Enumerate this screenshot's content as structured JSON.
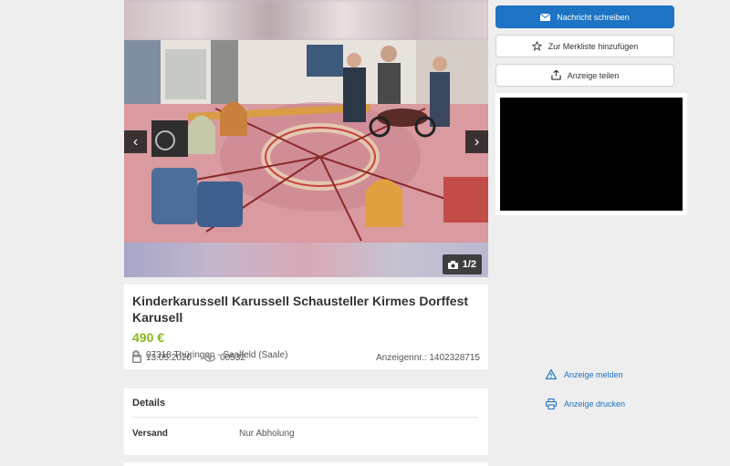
{
  "gallery": {
    "counter": "1/2",
    "prev_icon": "chevron-left-icon",
    "next_icon": "chevron-right-icon",
    "counter_icon": "camera-icon"
  },
  "ad": {
    "title": "Kinderkarussell Karussell Schausteller Kirmes Dorffest Karusell",
    "price": "490 €",
    "location": "07318 Thüringen - Saalfeld (Saale)",
    "date": "13.05.2020",
    "views": "00532",
    "ad_number": "Anzeigennr.: 1402328715"
  },
  "details": {
    "title": "Details",
    "rows": [
      {
        "label": "Versand",
        "value": "Nur Abholung"
      }
    ]
  },
  "sidebar": {
    "message_button": "Nachricht schreiben",
    "watchlist_button": "Zur Merkliste hinzufügen",
    "share_button": "Anzeige teilen",
    "report_link": "Anzeige melden",
    "print_link": "Anzeige drucken"
  },
  "colors": {
    "accent": "#1d73c4",
    "price": "#86b817",
    "background": "#eeeeee"
  }
}
